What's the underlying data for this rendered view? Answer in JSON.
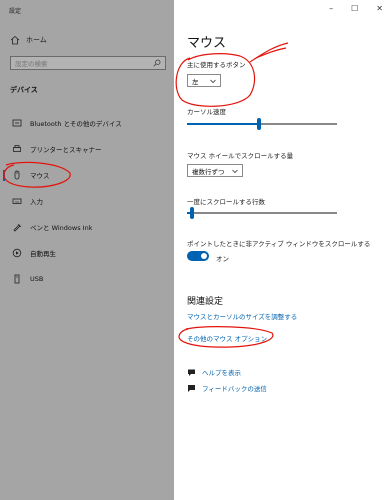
{
  "window": {
    "title": "設定",
    "controls": [
      "–",
      "☐",
      "✕"
    ]
  },
  "sidebar": {
    "home_label": "ホーム",
    "search": {
      "placeholder": "設定の検索",
      "value": ""
    },
    "section_title": "デバイス",
    "items": [
      {
        "label": "Bluetooth とその他のデバイス",
        "icon": "bluetooth-icon",
        "active": false
      },
      {
        "label": "プリンターとスキャナー",
        "icon": "printer-icon",
        "active": false
      },
      {
        "label": "マウス",
        "icon": "mouse-icon",
        "active": true
      },
      {
        "label": "入力",
        "icon": "keyboard-icon",
        "active": false
      },
      {
        "label": "ペンと Windows Ink",
        "icon": "pen-icon",
        "active": false
      },
      {
        "label": "自動再生",
        "icon": "autoplay-icon",
        "active": false
      },
      {
        "label": "USB",
        "icon": "usb-icon",
        "active": false
      }
    ]
  },
  "main": {
    "title": "マウス",
    "primary_button": {
      "label": "主に使用するボタン",
      "value": "左"
    },
    "cursor_speed": {
      "label": "カーソル速度",
      "level": 0.48
    },
    "wheel_scroll": {
      "label": "マウス ホイールでスクロールする量",
      "value": "複数行ずつ"
    },
    "lines_to_scroll": {
      "label": "一度にスクロールする行数",
      "level": 0.02
    },
    "inactive_scroll": {
      "label": "ポイントしたときに非アクティブ ウィンドウをスクロールする",
      "state": "オン"
    },
    "related": {
      "title": "関連設定",
      "links": [
        "マウスとカーソルのサイズを調整する",
        "その他のマウス オプション"
      ]
    },
    "help": [
      {
        "label": "ヘルプを表示",
        "icon": "help-chat-icon"
      },
      {
        "label": "フィードバックの送信",
        "icon": "feedback-icon"
      }
    ]
  },
  "colors": {
    "accent": "#0063b1",
    "sidebar_bg": "#a5a5a5",
    "annotation": "#e2140c"
  }
}
